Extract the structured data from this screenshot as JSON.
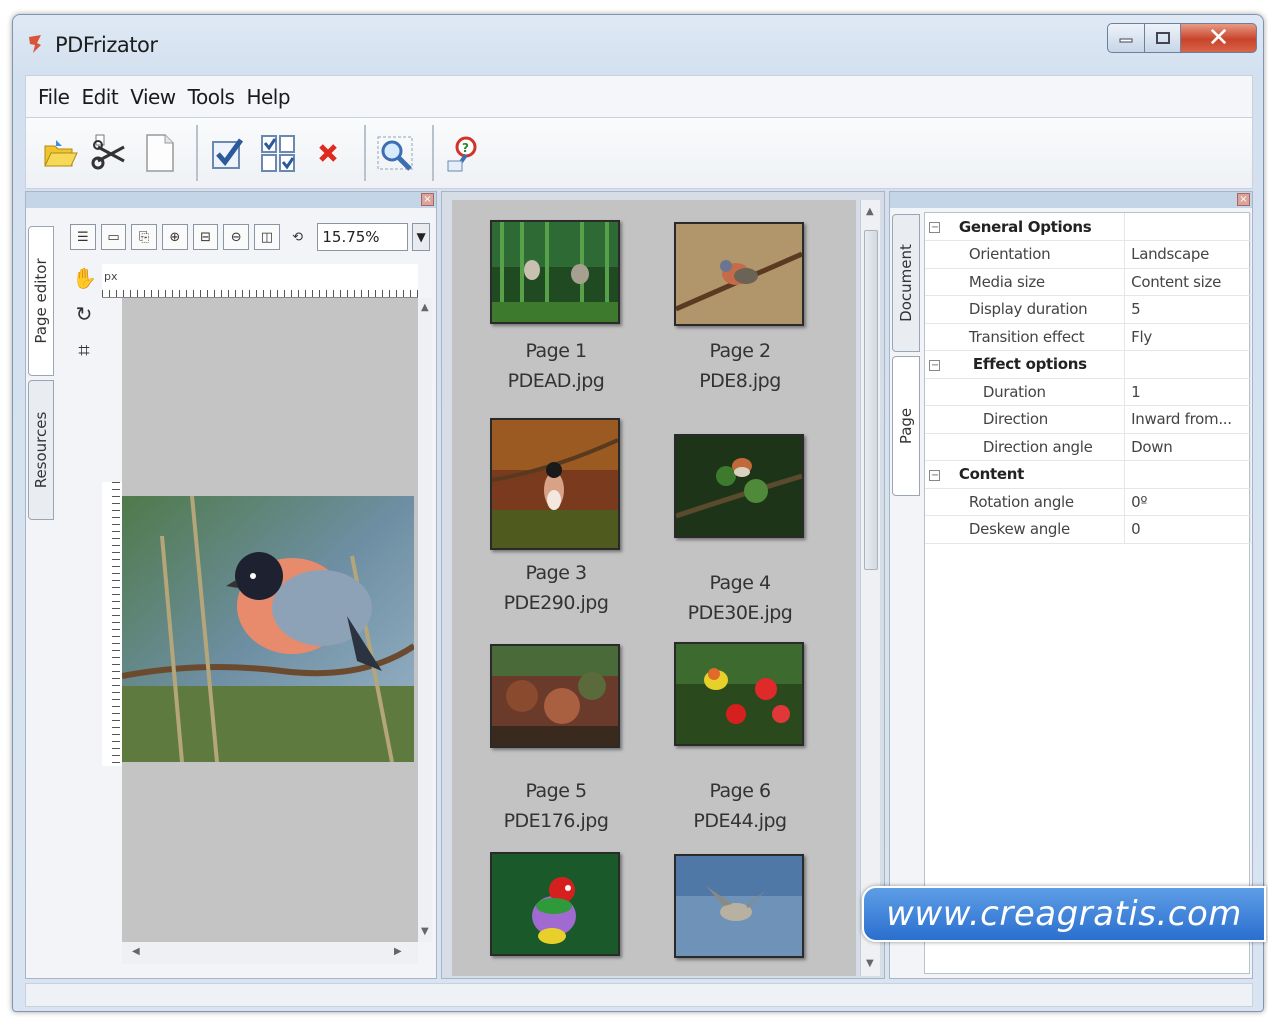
{
  "window": {
    "title": "PDFrizator"
  },
  "menu": [
    "File",
    "Edit",
    "View",
    "Tools",
    "Help"
  ],
  "toolbar": {
    "buttons": [
      "open-folder",
      "cut-scissors",
      "new-page",
      "check",
      "select-pages",
      "delete",
      "zoom-search",
      "help-wizard"
    ]
  },
  "left_panel": {
    "tabs": [
      "Page editor",
      "Resources"
    ],
    "zoom": "15.75%",
    "ruler_label": "px"
  },
  "thumbnails": [
    {
      "page": "Page 1",
      "file": "PDEAD.jpg"
    },
    {
      "page": "Page 2",
      "file": "PDE8.jpg"
    },
    {
      "page": "Page 3",
      "file": "PDE290.jpg"
    },
    {
      "page": "Page 4",
      "file": "PDE30E.jpg"
    },
    {
      "page": "Page 5",
      "file": "PDE176.jpg"
    },
    {
      "page": "Page 6",
      "file": "PDE44.jpg"
    }
  ],
  "right_panel": {
    "tabs": [
      "Document",
      "Page"
    ],
    "properties": {
      "general_header": "General Options",
      "orientation_label": "Orientation",
      "orientation_value": "Landscape",
      "media_label": "Media size",
      "media_value": "Content size",
      "duration_label": "Display duration",
      "duration_value": "5",
      "transition_label": "Transition effect",
      "transition_value": "Fly",
      "effect_header": "Effect options",
      "eff_duration_label": "Duration",
      "eff_duration_value": "1",
      "direction_label": "Direction",
      "direction_value": "Inward from...",
      "direction_angle_label": "Direction angle",
      "direction_angle_value": "Down",
      "content_header": "Content",
      "rotation_label": "Rotation angle",
      "rotation_value": "0º",
      "deskew_label": "Deskew angle",
      "deskew_value": "0"
    }
  },
  "watermark": "www.creagratis.com",
  "colors": {
    "titlebar": "#d3e0ef",
    "close_button": "#c8442a",
    "canvas_gray": "#c4c4c4",
    "watermark_blue": "#2b6fcf"
  }
}
